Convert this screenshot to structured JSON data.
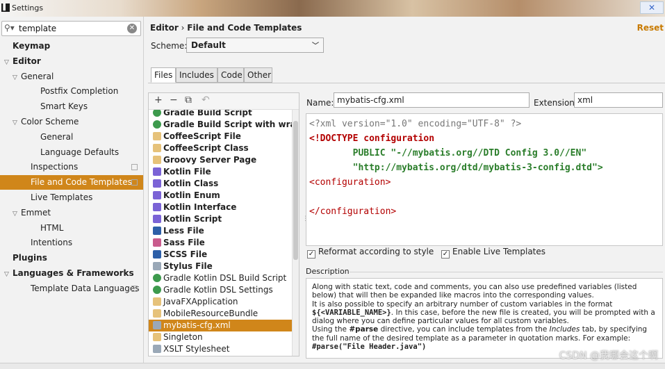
{
  "window": {
    "title": "Settings",
    "close": "✕"
  },
  "search": {
    "value": "template"
  },
  "tree": [
    {
      "label": "Keymap",
      "bold": true,
      "indent": 0,
      "arrow": ""
    },
    {
      "label": "Editor",
      "bold": true,
      "indent": 0,
      "arrow": "▽"
    },
    {
      "label": "General",
      "indent": 1,
      "arrow": "▽"
    },
    {
      "label": "Postfix Completion",
      "indent": 3,
      "arrow": ""
    },
    {
      "label": "Smart Keys",
      "indent": 3,
      "arrow": ""
    },
    {
      "label": "Color Scheme",
      "indent": 1,
      "arrow": "▽"
    },
    {
      "label": "General",
      "indent": 3,
      "arrow": ""
    },
    {
      "label": "Language Defaults",
      "indent": 3,
      "arrow": ""
    },
    {
      "label": "Inspections",
      "indent": 2,
      "arrow": "",
      "copy": true
    },
    {
      "label": "File and Code Templates",
      "indent": 2,
      "arrow": "",
      "copy": true,
      "selected": true
    },
    {
      "label": "Live Templates",
      "indent": 2,
      "arrow": ""
    },
    {
      "label": "Emmet",
      "indent": 1,
      "arrow": "▽"
    },
    {
      "label": "HTML",
      "indent": 3,
      "arrow": ""
    },
    {
      "label": "Intentions",
      "indent": 2,
      "arrow": ""
    },
    {
      "label": "Plugins",
      "bold": true,
      "indent": 0,
      "arrow": ""
    },
    {
      "label": "Languages & Frameworks",
      "bold": true,
      "indent": 0,
      "arrow": "▽"
    },
    {
      "label": "Template Data Languages",
      "indent": 2,
      "arrow": "",
      "copy": true
    }
  ],
  "breadcrumb": {
    "root": "Editor",
    "sep": "›",
    "leaf": "File and Code Templates"
  },
  "reset": "Reset",
  "scheme": {
    "label": "Scheme:",
    "value": "Default"
  },
  "tabs": [
    "Files",
    "Includes",
    "Code",
    "Other"
  ],
  "toolbar": {
    "add": "+",
    "remove": "−",
    "copy": "⧉",
    "revert": "↶"
  },
  "templates": [
    {
      "label": "Gradle Build Script",
      "icon": "g",
      "b": true
    },
    {
      "label": "Gradle Build Script with wrapper",
      "icon": "g",
      "b": true
    },
    {
      "label": "CoffeeScript File",
      "icon": "f",
      "b": true
    },
    {
      "label": "CoffeeScript Class",
      "icon": "f",
      "b": true
    },
    {
      "label": "Groovy Server Page",
      "icon": "f",
      "b": true
    },
    {
      "label": "Kotlin File",
      "icon": "k",
      "b": true
    },
    {
      "label": "Kotlin Class",
      "icon": "k",
      "b": true
    },
    {
      "label": "Kotlin Enum",
      "icon": "k",
      "b": true
    },
    {
      "label": "Kotlin Interface",
      "icon": "k",
      "b": true
    },
    {
      "label": "Kotlin Script",
      "icon": "k",
      "b": true
    },
    {
      "label": "Less File",
      "icon": "l",
      "b": true
    },
    {
      "label": "Sass File",
      "icon": "s",
      "b": true
    },
    {
      "label": "SCSS File",
      "icon": "l",
      "b": true
    },
    {
      "label": "Stylus File",
      "icon": "c",
      "b": true
    },
    {
      "label": "Gradle Kotlin DSL Build Script",
      "icon": "g"
    },
    {
      "label": "Gradle Kotlin DSL Settings",
      "icon": "g"
    },
    {
      "label": "JavaFXApplication",
      "icon": "f"
    },
    {
      "label": "MobileResourceBundle",
      "icon": "f"
    },
    {
      "label": "mybatis-cfg.xml",
      "icon": "c",
      "selected": true
    },
    {
      "label": "Singleton",
      "icon": "f"
    },
    {
      "label": "XSLT Stylesheet",
      "icon": "c"
    }
  ],
  "name": {
    "label": "Name:",
    "value": "mybatis-cfg.xml"
  },
  "extension": {
    "label": "Extension:",
    "value": "xml"
  },
  "code": {
    "l1": "<?xml version=\"1.0\" encoding=\"UTF-8\" ?>",
    "l2a": "<!DOCTYPE ",
    "l2b": "configuration",
    "l3a": "        PUBLIC ",
    "l3b": "\"-//mybatis.org//DTD Config 3.0//EN\"",
    "l4": "        \"http://mybatis.org/dtd/mybatis-3-config.dtd\">",
    "l5": "<configuration>",
    "l6": "</configuration>"
  },
  "options": {
    "reformat": "Reformat according to style",
    "live": "Enable Live Templates"
  },
  "description": {
    "label": "Description",
    "p1": "Along with static text, code and comments, you can also use predefined variables (listed below) that will then be expanded like macros into the corresponding values.",
    "p2a": "It is also possible to specify an arbitrary number of custom variables in the format ",
    "p2b": "${<VARIABLE_NAME>}",
    "p2c": ". In this case, before the new file is created, you will be prompted with a dialog where you can define particular values for all custom variables.",
    "p3a": "Using the ",
    "p3b": "#parse",
    "p3c": " directive, you can include templates from the ",
    "p3d": "Includes",
    "p3e": " tab, by specifying the full name of the desired template as a parameter in quotation marks. For example:",
    "p4": "#parse(\"File Header.java\")"
  },
  "watermark": "CSDN @我哪会这个啊"
}
